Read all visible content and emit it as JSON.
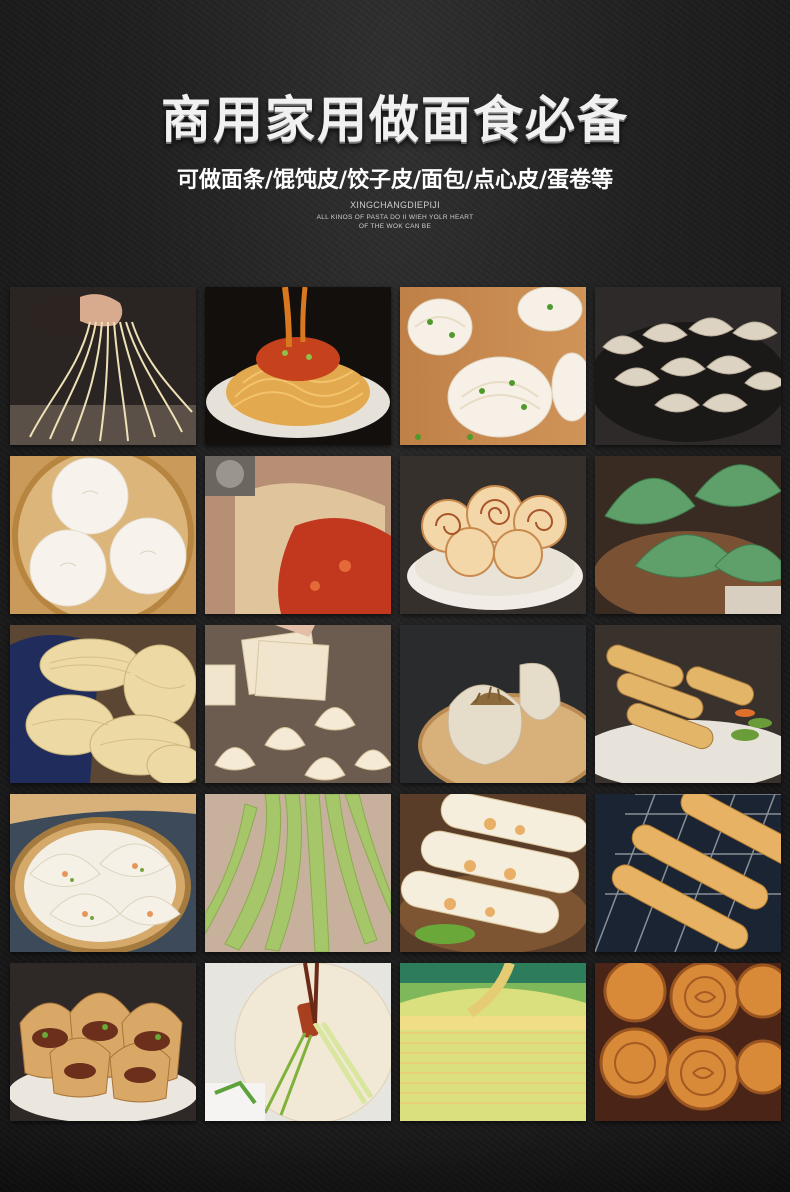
{
  "header": {
    "title": "商用家用做面食必备",
    "subtitle": "可做面条/馄饨皮/饺子皮/面包/点心皮/蛋卷等",
    "caption_line1": "XINGCHANGDIEPIJI",
    "caption_line2": "ALL KINOS OF PASTA DO II WIEH YOLR HEART",
    "caption_line3": "OF THE WOK CAN BE"
  },
  "gallery": {
    "rows": 5,
    "columns": 4,
    "tiles": [
      "hand-pulled-noodles",
      "noodles-with-sauce",
      "scallion-rolls",
      "dumplings-on-pan",
      "steamed-buns",
      "pizza-dough",
      "cinnamon-roll-buns",
      "green-dumplings",
      "dried-noodle-nests",
      "wonton-wrappers",
      "soup-dumpling",
      "spring-rolls",
      "steamed-dumplings",
      "green-noodles",
      "egg-pancake-rolls",
      "fried-dough-sticks",
      "stuffed-flatbread",
      "peking-duck-wraps",
      "layered-crepe-cake",
      "mooncakes"
    ]
  }
}
